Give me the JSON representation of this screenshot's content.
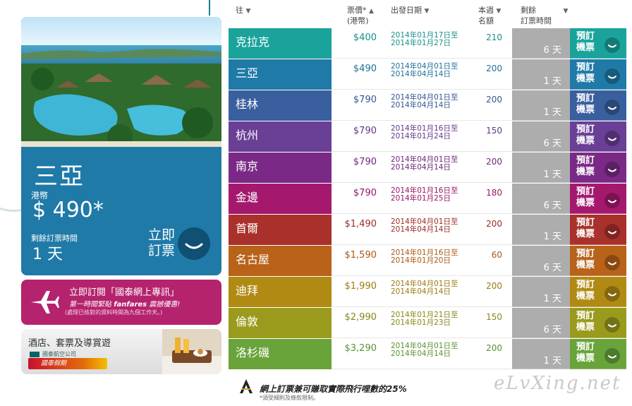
{
  "promo": {
    "city": "三亞",
    "currency": "港幣",
    "price": "$ 490*",
    "remain_label": "剩餘訂票時間",
    "remain_value": "1 天",
    "book_line1": "立即",
    "book_line2": "訂票"
  },
  "newsletter": {
    "line1": "立即訂閱「國泰網上專訊」",
    "line2_pre": "第一時間緊貼 ",
    "line2_bold": "fanfares",
    "line2_post": " 震撼優惠!",
    "line3": "(處理已核對的資料時間為九個工作天。)"
  },
  "hotel": {
    "title": "酒店、套票及導賞遊",
    "airline": "國泰航空公司",
    "badge": "國泰假期"
  },
  "header": {
    "dest": "往",
    "price_line1": "票價*",
    "price_line2": "(港幣)",
    "depart": "出發日期",
    "seats_line1": "本週",
    "seats_line2": "名額",
    "remain_line1": "剩餘",
    "remain_line2": "訂票時間",
    "arrow_down": "▼",
    "arrow_up": "▲"
  },
  "rows": [
    {
      "city": "克拉克",
      "price": "$400",
      "date1": "2014年01月17日至",
      "date2": "2014年01月27日",
      "seats": "210",
      "remain": "6 天",
      "book1": "預訂",
      "book2": "機票",
      "color": "#1aa39b",
      "text_color": "#168f88"
    },
    {
      "city": "三亞",
      "price": "$490",
      "date1": "2014年04月01日至",
      "date2": "2014年04月14日",
      "seats": "200",
      "remain": "1 天",
      "book1": "預訂",
      "book2": "機票",
      "color": "#1f7aa8",
      "text_color": "#1f6f98"
    },
    {
      "city": "桂林",
      "price": "$790",
      "date1": "2014年04月01日至",
      "date2": "2014年04月14日",
      "seats": "200",
      "remain": "1 天",
      "book1": "預訂",
      "book2": "機票",
      "color": "#3a5f9f",
      "text_color": "#33558f"
    },
    {
      "city": "杭州",
      "price": "$790",
      "date1": "2014年01月16日至",
      "date2": "2014年01月24日",
      "seats": "150",
      "remain": "6 天",
      "book1": "預訂",
      "book2": "機票",
      "color": "#6a3f96",
      "text_color": "#603889"
    },
    {
      "city": "南京",
      "price": "$790",
      "date1": "2014年04月01日至",
      "date2": "2014年04月14日",
      "seats": "200",
      "remain": "1 天",
      "book1": "預訂",
      "book2": "機票",
      "color": "#7a2a86",
      "text_color": "#6e257a"
    },
    {
      "city": "金邊",
      "price": "$790",
      "date1": "2014年01月16日至",
      "date2": "2014年01月25日",
      "seats": "180",
      "remain": "6 天",
      "book1": "預訂",
      "book2": "機票",
      "color": "#a4196e",
      "text_color": "#961765"
    },
    {
      "city": "首爾",
      "price": "$1,490",
      "date1": "2014年04月01日至",
      "date2": "2014年04月14日",
      "seats": "200",
      "remain": "1 天",
      "book1": "預訂",
      "book2": "機票",
      "color": "#a9302b",
      "text_color": "#9a2b27"
    },
    {
      "city": "名古屋",
      "price": "$1,590",
      "date1": "2014年01月16日至",
      "date2": "2014年01月20日",
      "seats": "60",
      "remain": "6 天",
      "book1": "預訂",
      "book2": "機票",
      "color": "#b8621a",
      "text_color": "#a85816"
    },
    {
      "city": "迪拜",
      "price": "$1,990",
      "date1": "2014年04月01日至",
      "date2": "2014年04月14日",
      "seats": "200",
      "remain": "1 天",
      "book1": "預訂",
      "book2": "機票",
      "color": "#b18a13",
      "text_color": "#9c7a10"
    },
    {
      "city": "倫敦",
      "price": "$2,990",
      "date1": "2014年01月21日至",
      "date2": "2014年01月23日",
      "seats": "150",
      "remain": "6 天",
      "book1": "預訂",
      "book2": "機票",
      "color": "#9a9a1c",
      "text_color": "#868617"
    },
    {
      "city": "洛杉磯",
      "price": "$3,290",
      "date1": "2014年04月01日至",
      "date2": "2014年04月14日",
      "seats": "200",
      "remain": "1 天",
      "book1": "預訂",
      "book2": "機票",
      "color": "#69a33a",
      "text_color": "#5a9230"
    }
  ],
  "footer": {
    "line1": "網上訂票兼可賺取實際飛行哩數的25%",
    "line2": "*須受細則及條款限制。"
  },
  "watermark": "eLvXing.net"
}
